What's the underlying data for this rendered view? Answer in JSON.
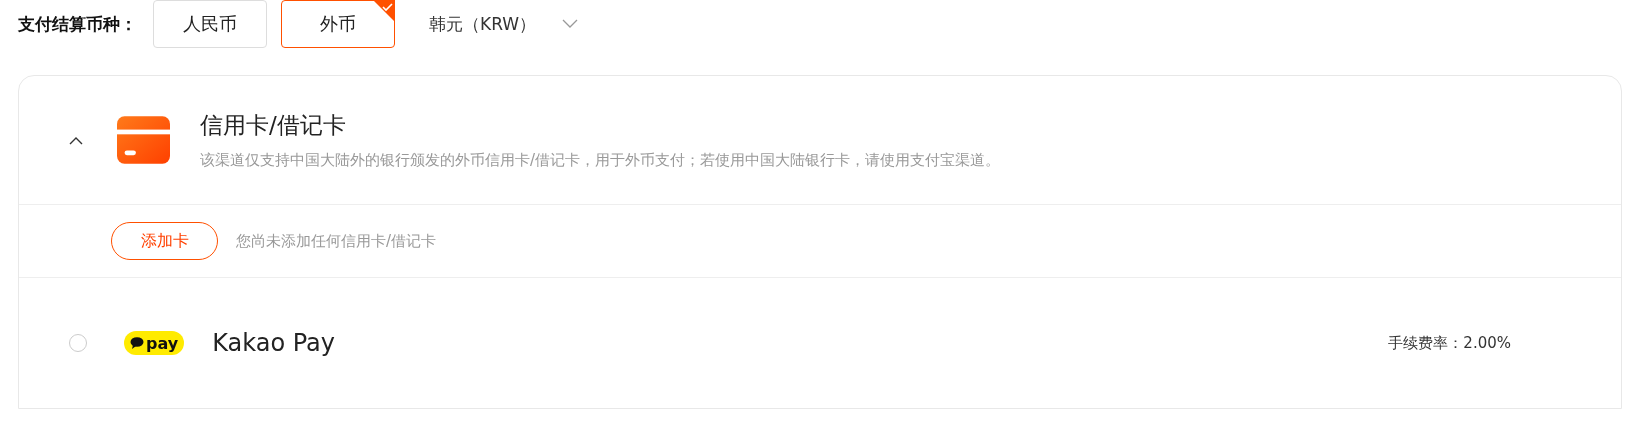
{
  "currency": {
    "label": "支付结算币种：",
    "options": [
      {
        "label": "人民币",
        "selected": false
      },
      {
        "label": "外币",
        "selected": true
      }
    ],
    "dropdown": {
      "value": "韩元（KRW）"
    }
  },
  "methods": [
    {
      "kind": "card",
      "expanded": true,
      "title": "信用卡/借记卡",
      "description": "该渠道仅支持中国大陆外的银行颁发的外币信用卡/借记卡，用于外币支付；若使用中国大陆银行卡，请使用支付宝渠道。",
      "add_button": "添加卡",
      "empty_text": "您尚未添加任何信用卡/借记卡"
    },
    {
      "kind": "wallet",
      "selected": false,
      "logo_text": "pay",
      "title": "Kakao Pay",
      "fee": "手续费率：2.00%"
    }
  ]
}
